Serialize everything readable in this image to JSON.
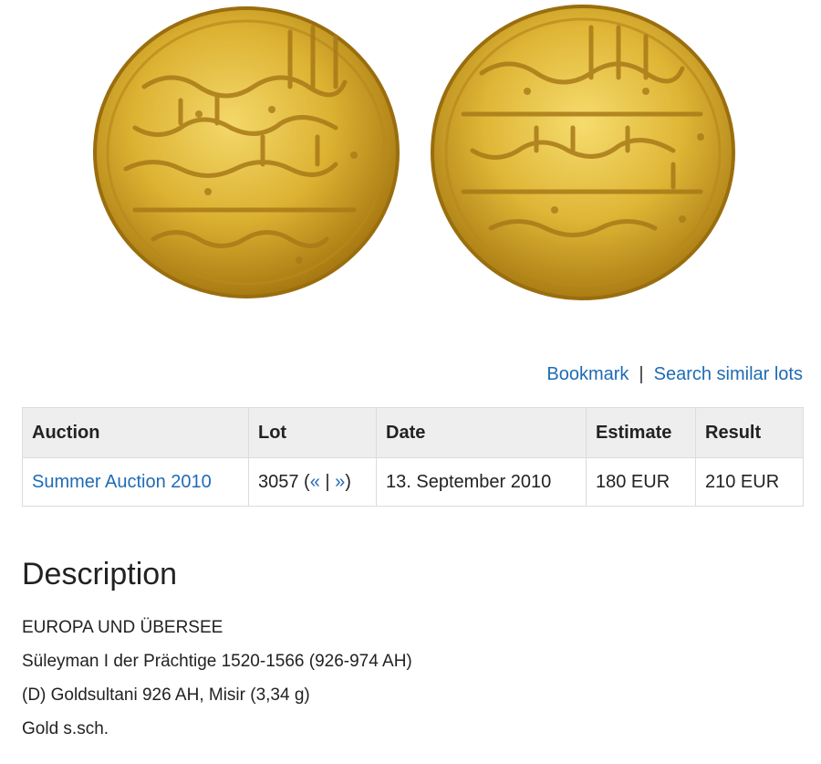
{
  "image": {
    "alt": "Gold coin obverse and reverse with Arabic inscriptions"
  },
  "actions": {
    "bookmark": "Bookmark",
    "separator": "|",
    "search_similar": "Search similar lots"
  },
  "table": {
    "headers": [
      "Auction",
      "Lot",
      "Date",
      "Estimate",
      "Result"
    ],
    "row": {
      "auction": "Summer Auction 2010",
      "lot_number": "3057",
      "lot_prev": "«",
      "lot_sep": "|",
      "lot_next": "»",
      "date": "13. September 2010",
      "estimate": "180 EUR",
      "result": "210 EUR"
    }
  },
  "description": {
    "title": "Description",
    "lines": [
      "EUROPA UND ÜBERSEE",
      "Süleyman I der Prächtige 1520-1566 (926-974 AH)",
      "(D) Goldsultani 926 AH, Misir (3,34 g)",
      "Gold s.sch."
    ]
  },
  "colors": {
    "link": "#1f6bb5",
    "header_bg": "#eeeeee",
    "gold": "#d9b23a"
  }
}
